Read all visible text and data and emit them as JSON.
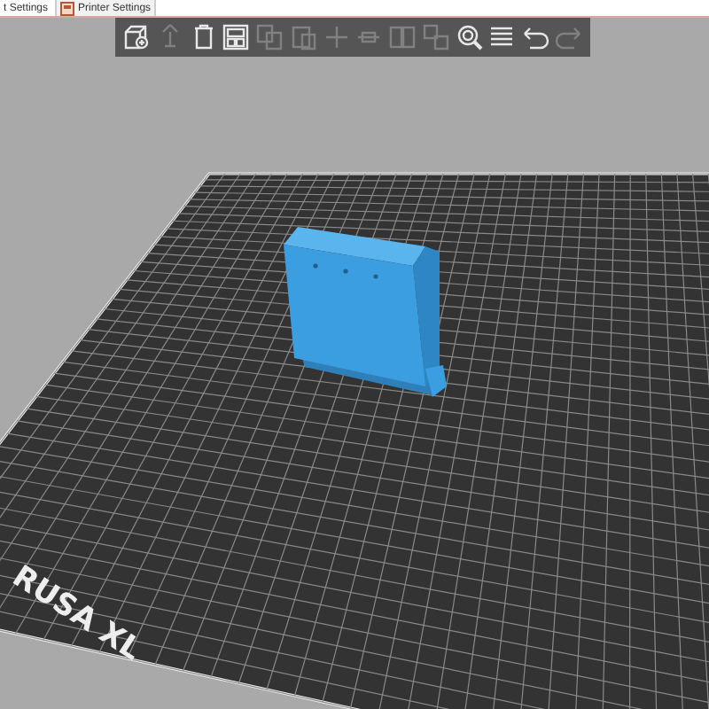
{
  "tabs": [
    {
      "label": "t Settings",
      "selected": false
    },
    {
      "label": "Printer Settings",
      "selected": true
    }
  ],
  "toolbar": [
    {
      "kind": "add",
      "disabled": false
    },
    {
      "kind": "delete",
      "disabled": true
    },
    {
      "kind": "delete_all",
      "disabled": false
    },
    {
      "kind": "arrange",
      "disabled": false
    },
    {
      "kind": "copy",
      "disabled": true
    },
    {
      "kind": "paste",
      "disabled": true
    },
    {
      "kind": "add_instance",
      "disabled": true
    },
    {
      "kind": "remove_instance",
      "disabled": true
    },
    {
      "kind": "split_objects",
      "disabled": true
    },
    {
      "kind": "split_parts",
      "disabled": true
    },
    {
      "kind": "search",
      "disabled": false
    },
    {
      "kind": "layers",
      "disabled": false
    },
    {
      "kind": "undo",
      "disabled": false
    },
    {
      "kind": "redo",
      "disabled": true
    }
  ],
  "bed": {
    "label": "RUSA XL"
  }
}
